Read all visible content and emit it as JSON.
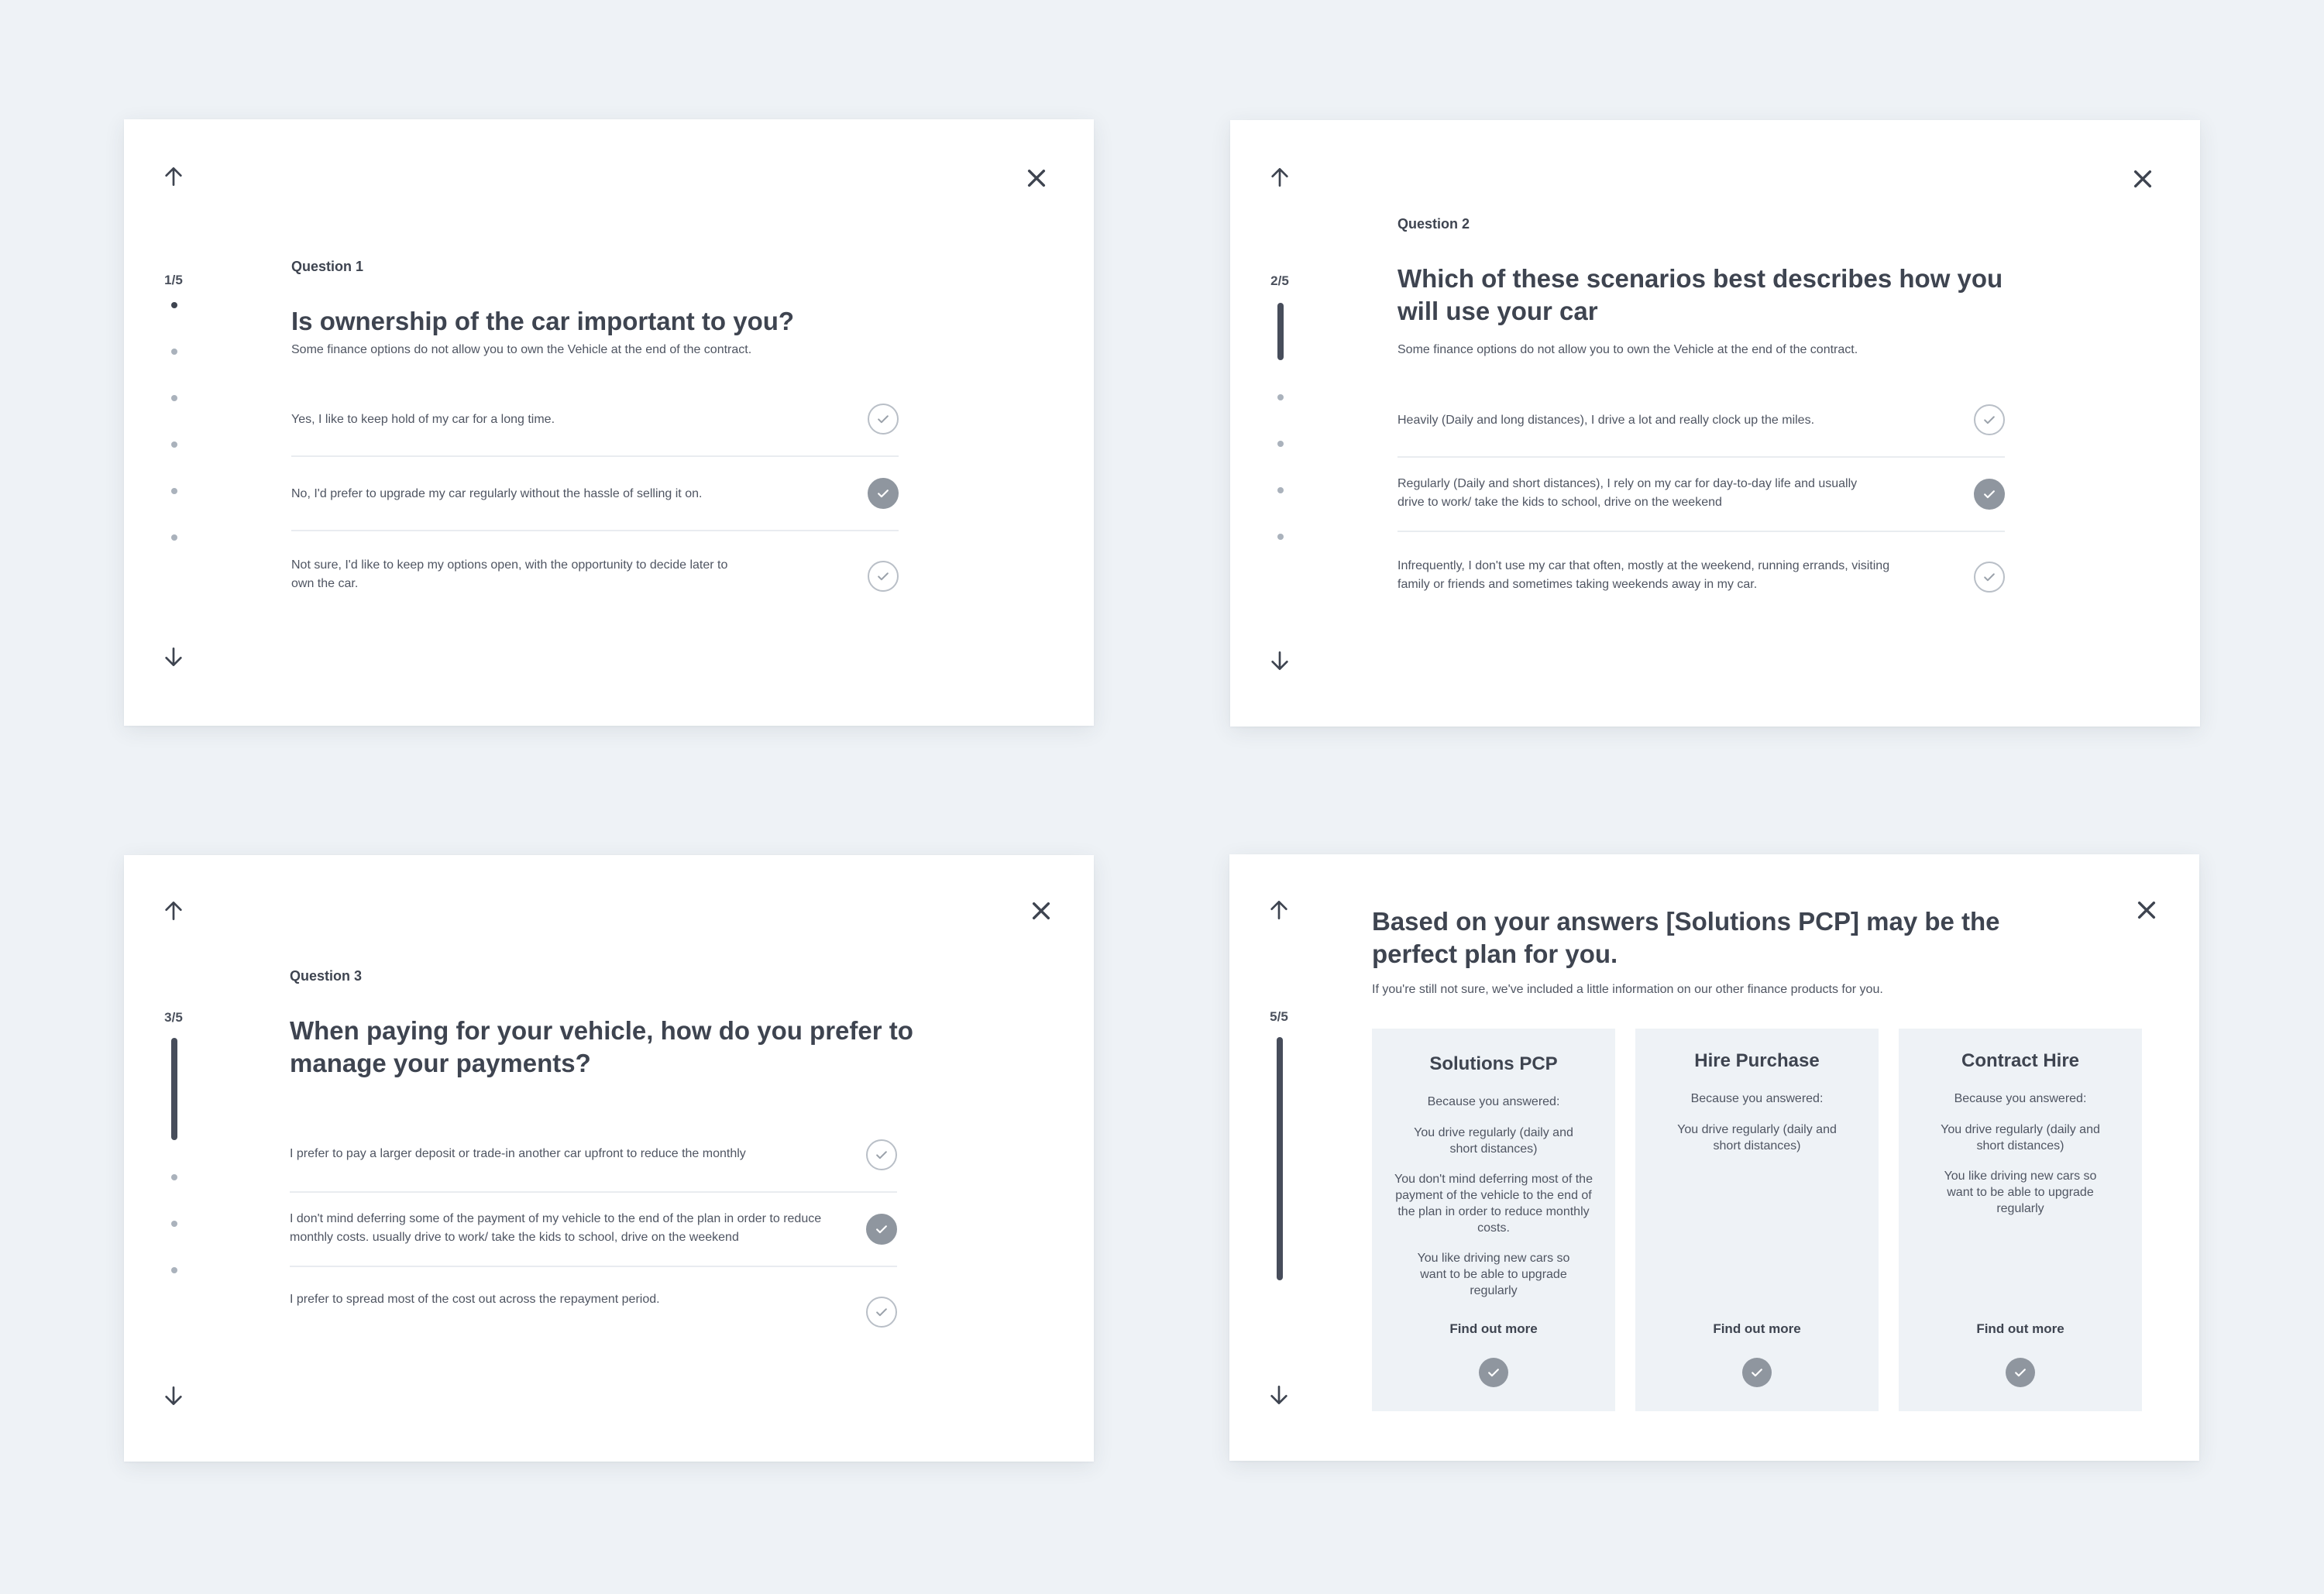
{
  "colors": {
    "background": "#eef2f6",
    "text": "#3e4450",
    "check_filled": "#8f969f",
    "progress_bar": "#474d5b"
  },
  "icons": {
    "up": "arrow-up-icon",
    "down": "arrow-down-icon",
    "close": "close-icon",
    "check": "check-icon"
  },
  "q1": {
    "step": "1/5",
    "label": "Question 1",
    "title": "Is ownership of the car important to you?",
    "subtitle": "Some finance options do not allow you to own the Vehicle at the end of the contract.",
    "answers": [
      {
        "text": "Yes, I like to keep hold of my car for a long time.",
        "selected": false
      },
      {
        "text": "No, I'd prefer to upgrade my car regularly without the hassle of selling it on.",
        "selected": true
      },
      {
        "text": "Not sure, I'd like to keep my options open, with the opportunity to decide later to own the car.",
        "selected": false
      }
    ]
  },
  "q2": {
    "step": "2/5",
    "label": "Question 2",
    "title": "Which of these scenarios best describes how you will use your car",
    "subtitle": "Some finance options do not allow you to own the Vehicle at the end of the contract.",
    "answers": [
      {
        "text": "Heavily (Daily and long distances), I drive a lot and really clock up the miles.",
        "selected": false
      },
      {
        "text": "Regularly (Daily and short distances), I rely on my car for day-to-day life and usually drive to work/ take the kids to school, drive on the weekend",
        "selected": true
      },
      {
        "text": "Infrequently, I don't use my car that often, mostly at the weekend, running errands, visiting family or friends and sometimes taking weekends away in my car.",
        "selected": false
      }
    ]
  },
  "q3": {
    "step": "3/5",
    "label": "Question 3",
    "title": "When paying for your vehicle, how do you prefer to manage your payments?",
    "answers": [
      {
        "text": "I prefer to pay a larger deposit or trade-in another car upfront to reduce the monthly",
        "selected": false
      },
      {
        "text": "I don't mind deferring some of the payment of my vehicle to the end of the plan in order to reduce monthly costs. usually drive to work/ take the kids to school, drive on the weekend",
        "selected": true
      },
      {
        "text": "I prefer to spread most of the cost out across the repayment period.",
        "selected": false
      }
    ]
  },
  "result": {
    "step": "5/5",
    "title": "Based on your answers [Solutions PCP] may be the perfect plan for you.",
    "subtitle": "If you're still not sure, we've included a little information on our other finance products for you.",
    "products": [
      {
        "name": "Solutions PCP",
        "because": "Because you answered:",
        "reasons": [
          "You drive regularly (daily and short distances)",
          "You don't mind deferring most of the payment of the vehicle to the end of the plan in order to reduce monthly costs.",
          "You like driving new cars so want to be able to upgrade regularly"
        ],
        "cta": "Find out more"
      },
      {
        "name": "Hire Purchase",
        "because": "Because you answered:",
        "reasons": [
          "You drive regularly (daily and short distances)"
        ],
        "cta": "Find out more"
      },
      {
        "name": "Contract Hire",
        "because": "Because you answered:",
        "reasons": [
          "You drive regularly (daily and short distances)",
          "You like driving new cars so want to be able to upgrade regularly"
        ],
        "cta": "Find out more"
      }
    ]
  }
}
